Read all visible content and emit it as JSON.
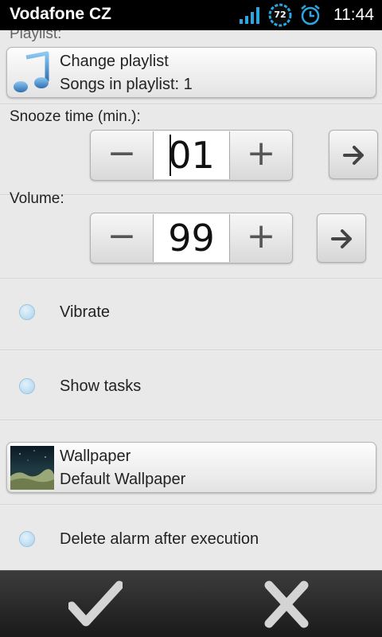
{
  "status_bar": {
    "carrier": "Vodafone CZ",
    "battery_level": "72",
    "time": "11:44",
    "icons": [
      "signal-icon",
      "battery-icon",
      "alarm-clock-icon"
    ],
    "accent_color": "#2aa7e0"
  },
  "playlist": {
    "section_label": "Playlist:",
    "button_title": "Change playlist",
    "button_subtitle": "Songs in playlist: 1",
    "icon": "music-note-icon"
  },
  "snooze": {
    "label": "Snooze time (min.):",
    "minus": "−",
    "value": "01",
    "plus": "+",
    "go_icon": "arrow-right-icon"
  },
  "volume": {
    "label": "Volume:",
    "minus": "−",
    "value": "99",
    "plus": "+",
    "go_icon": "arrow-right-icon"
  },
  "options": {
    "vibrate": "Vibrate",
    "show_tasks": "Show tasks",
    "delete_alarm": "Delete alarm after execution"
  },
  "wallpaper": {
    "title": "Wallpaper",
    "subtitle": "Default Wallpaper",
    "icon": "wallpaper-thumbnail"
  },
  "bottom_bar": {
    "confirm_icon": "checkmark-icon",
    "cancel_icon": "close-icon"
  }
}
